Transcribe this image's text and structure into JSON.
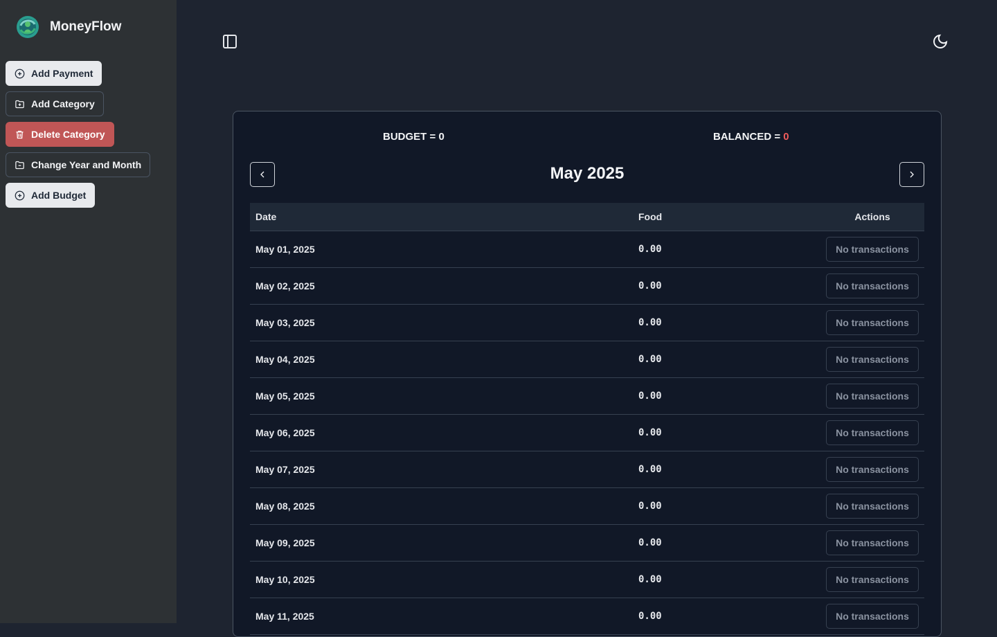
{
  "brand": {
    "name": "MoneyFlow"
  },
  "sidebar": {
    "buttons": [
      {
        "label": "Add Payment",
        "icon": "plus-circle-icon"
      },
      {
        "label": "Add Category",
        "icon": "folder-plus-icon"
      },
      {
        "label": "Delete Category",
        "icon": "trash-icon"
      },
      {
        "label": "Change Year and Month",
        "icon": "folder-icon"
      },
      {
        "label": "Add Budget",
        "icon": "plus-circle-icon"
      }
    ]
  },
  "summary": {
    "budget_label": "BUDGET = ",
    "budget_value": "0",
    "balanced_label": "BALANCED = ",
    "balanced_value": "0"
  },
  "calendar": {
    "month_title": "May 2025"
  },
  "table": {
    "headers": [
      "Date",
      "Food",
      "Actions"
    ],
    "rows": [
      {
        "date": "May 01, 2025",
        "food": "0.00",
        "action": "No transactions"
      },
      {
        "date": "May 02, 2025",
        "food": "0.00",
        "action": "No transactions"
      },
      {
        "date": "May 03, 2025",
        "food": "0.00",
        "action": "No transactions"
      },
      {
        "date": "May 04, 2025",
        "food": "0.00",
        "action": "No transactions"
      },
      {
        "date": "May 05, 2025",
        "food": "0.00",
        "action": "No transactions"
      },
      {
        "date": "May 06, 2025",
        "food": "0.00",
        "action": "No transactions"
      },
      {
        "date": "May 07, 2025",
        "food": "0.00",
        "action": "No transactions"
      },
      {
        "date": "May 08, 2025",
        "food": "0.00",
        "action": "No transactions"
      },
      {
        "date": "May 09, 2025",
        "food": "0.00",
        "action": "No transactions"
      },
      {
        "date": "May 10, 2025",
        "food": "0.00",
        "action": "No transactions"
      },
      {
        "date": "May 11, 2025",
        "food": "0.00",
        "action": "No transactions"
      }
    ]
  },
  "colors": {
    "sidebar_bg": "#2d3134",
    "main_bg": "#1e2430",
    "card_bg": "#111827",
    "danger": "#c05656",
    "balanced_value": "#ef5b5b"
  }
}
